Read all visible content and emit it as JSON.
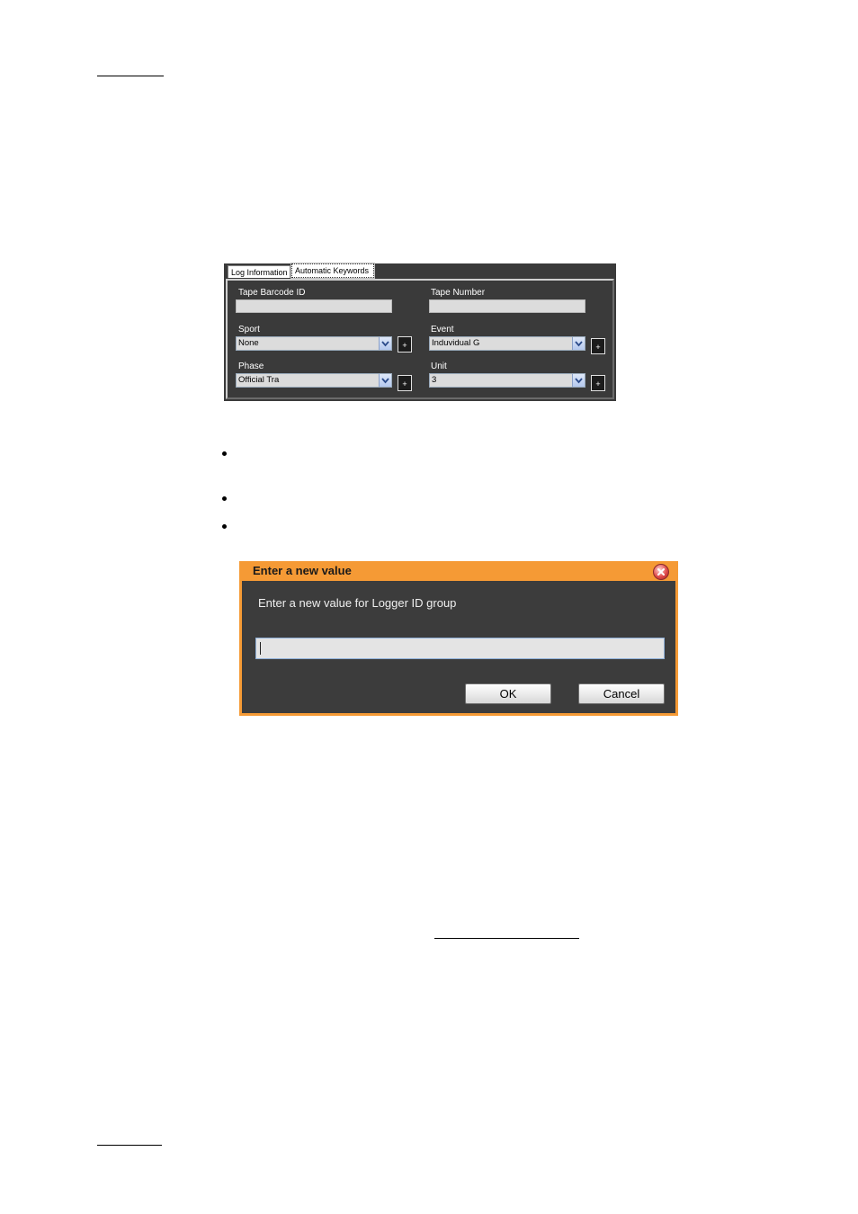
{
  "keywords_panel": {
    "tabs": [
      {
        "label": "Log Information"
      },
      {
        "label": "Automatic Keywords"
      }
    ],
    "fields": {
      "tape_barcode_label": "Tape Barcode ID",
      "tape_number_label": "Tape Number",
      "sport_label": "Sport",
      "sport_value": "None",
      "event_label": "Event",
      "event_value": "Induvidual G",
      "phase_label": "Phase",
      "phase_value": "Official Tra",
      "unit_label": "Unit",
      "unit_value": "3",
      "add_symbol": "+"
    }
  },
  "dialog": {
    "title": "Enter a new value",
    "prompt": "Enter a new value for Logger ID group",
    "input_value": "",
    "ok_label": "OK",
    "cancel_label": "Cancel"
  },
  "colors": {
    "panel_bg": "#3a3a3a",
    "dialog_title_bar": "#f59a35",
    "dialog_bg": "#3c3c3c"
  }
}
